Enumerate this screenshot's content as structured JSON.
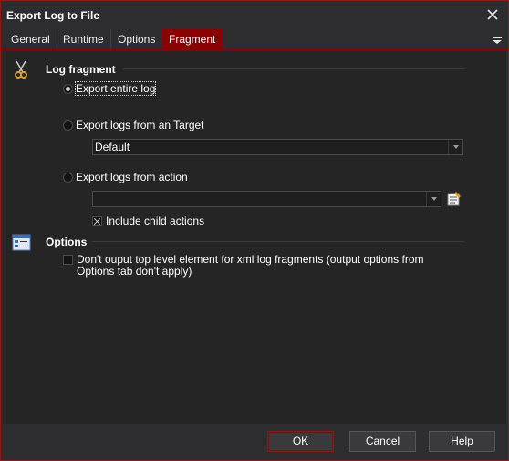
{
  "window": {
    "title": "Export Log to File",
    "close_icon": "close-icon"
  },
  "tabs": [
    {
      "label": "General",
      "active": false
    },
    {
      "label": "Runtime",
      "active": false
    },
    {
      "label": "Options",
      "active": false
    },
    {
      "label": "Fragment",
      "active": true
    }
  ],
  "log_fragment": {
    "title": "Log fragment",
    "icon": "scissors-icon",
    "export_entire_label": "Export entire log",
    "export_target_label": "Export logs from an Target",
    "target_value": "Default",
    "export_action_label": "Export logs from action",
    "action_value": "",
    "include_child_label": "Include child actions",
    "include_child_checked": true,
    "selected_option": "export_entire"
  },
  "options": {
    "title": "Options",
    "icon": "options-window-icon",
    "no_output_label": "Don't ouput top level element for xml log fragments (output options from Options tab don't apply)",
    "no_output_checked": false
  },
  "buttons": {
    "ok": "OK",
    "cancel": "Cancel",
    "help": "Help"
  },
  "colors": {
    "accent": "#8b0000",
    "background": "#2d2d30",
    "panel": "#252526"
  }
}
